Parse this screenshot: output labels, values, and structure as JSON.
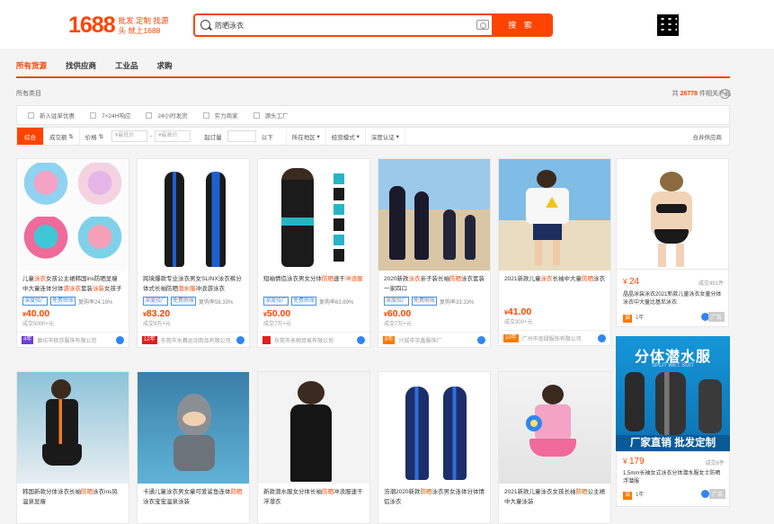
{
  "header": {
    "logo_num": "1688",
    "logo_tag": "批发 定制 找源头 就上1688",
    "search_value": "防晒泳衣",
    "search_button": "搜 索"
  },
  "tabs": [
    "所有货源",
    "找供应商",
    "工业品",
    "求购"
  ],
  "crumb": "所有类目",
  "count_prefix": "共",
  "count": "26778",
  "count_suffix": "件相关产品",
  "filters": [
    "新入驻单优惠",
    "7×24H响应",
    "24小时发货",
    "实力商家",
    "源头工厂"
  ],
  "sortbar": {
    "items": [
      "综合",
      "成交额",
      "价格"
    ],
    "price_low": "¥最低价",
    "price_high": "¥最高价",
    "min_order": "起订量",
    "below": "以下",
    "dropdowns": [
      "所在地区",
      "经营模式",
      "深度认证"
    ],
    "right": "合并供应商"
  },
  "row1": [
    {
      "title": [
        "儿童",
        "泳衣",
        "女孩公主裙韩国ins防晒显瘦中大童连体分体",
        "游泳衣",
        "套装",
        "泳装",
        "女孩子"
      ],
      "tags": [
        "深度验厂",
        "免费赊账"
      ],
      "rate": "复购率24.19%",
      "price": "40.00",
      "sold": "成交5000+元",
      "badge": "4年",
      "seller": "廊坊市依莎服饰有限公司"
    },
    {
      "title": [
        "跨境爆款专业泳衣男女SLINX泳衣裤分体式长袖防晒",
        "潜水服",
        "冲浪游泳衣",
        "",
        "",
        "",
        ""
      ],
      "tags": [
        "深度验厂",
        "免费赊账"
      ],
      "rate": "复购率58.33%",
      "price": "83.20",
      "sold": "成交9万+元",
      "badge": "12年",
      "seller": "东莞市水舞运动用品有限公司"
    },
    {
      "title": [
        "短袖情侣泳衣男女分体",
        "防晒",
        "速干",
        "冲浪服",
        "",
        "",
        ""
      ],
      "tags": [
        "深度验厂",
        "免费赊账"
      ],
      "rate": "复购率63.89%",
      "price": "50.00",
      "sold": "成交7万+元",
      "badge": "",
      "seller": "东莞市永翔贸易有限公司"
    },
    {
      "title": [
        "2020新款",
        "泳衣",
        "亲子装长袖",
        "防晒",
        "泳衣套装一家四口",
        "",
        ""
      ],
      "tags": [
        "深度验厂",
        "免费赊账"
      ],
      "rate": "复购率33.33%",
      "price": "60.00",
      "sold": "成交7万+元",
      "badge": "8年",
      "seller": "兴城市宇鑫服饰厂"
    },
    {
      "title": [
        "2021新款儿童",
        "泳衣",
        "长袖中大童",
        "防晒",
        "泳衣",
        "",
        ""
      ],
      "tags": [],
      "rate": "",
      "price": "41.00",
      "sold": "成交300+元",
      "badge": "10年",
      "seller": "广州市南绿服饰有限公司"
    }
  ],
  "right1": {
    "price": "24",
    "sold": "成交491件",
    "title": "晶晶泳装泳衣2021新款儿童泳衣女童分体泳衣中大童比基尼泳衣",
    "years": "1年",
    "ad_label": "广告"
  },
  "ad": {
    "title": "分体潜水服",
    "sub": "SPLIT WET SUIT",
    "bottom": "厂家直销 批发定制"
  },
  "right2": {
    "price": "179",
    "sold": "成交6件",
    "title": "1.5mm长袖女式泳衣分体潜水服女士防晒浮潜服",
    "years": "1年",
    "ad_label": "广告"
  },
  "row2": [
    {
      "title": "韩国新款分体泳衣长袖",
      "hl": "防晒",
      "title2": "泳衣ins风温泉显瘦"
    },
    {
      "title": "卡通儿童泳衣男女童可爱鲨鱼连体",
      "hl": "防晒",
      "title2": "泳衣宝宝温泉泳装"
    },
    {
      "title": "新款潜水服女分体长袖",
      "hl": "防晒",
      "title2": "冲浪服速干浮潜衣"
    },
    {
      "title": "浩潮2020新款",
      "hl": "防晒",
      "title2": "泳衣男女连体分体情侣泳衣"
    },
    {
      "title": "2021新款儿童泳衣女孩长袖",
      "hl": "防晒",
      "title2": "公主裙中大童泳装"
    }
  ]
}
